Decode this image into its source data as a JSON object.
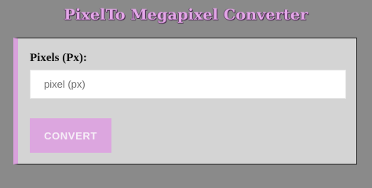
{
  "header": {
    "title": "PixelTo Megapixel Converter"
  },
  "form": {
    "pixels_label": "Pixels (Px):",
    "pixels_input": {
      "value": "",
      "placeholder": "pixel (px)"
    },
    "convert_label": "CONVERT"
  },
  "colors": {
    "background": "#8a8a8a",
    "card_background": "#d4d4d4",
    "accent": "#d9a1dc",
    "button": "#dca6df"
  }
}
